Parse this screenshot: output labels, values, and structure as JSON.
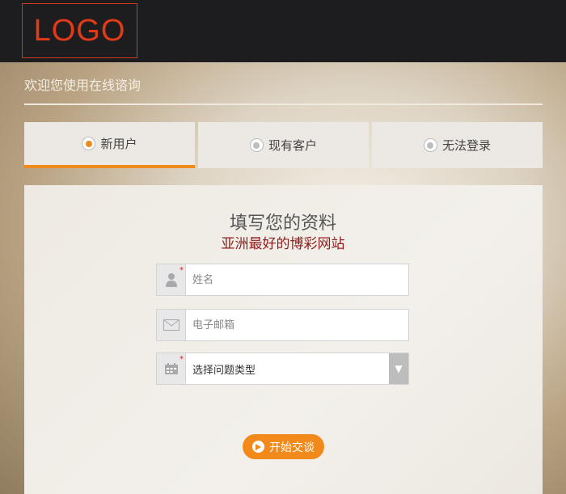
{
  "header": {
    "logo_text": "LOGO"
  },
  "welcome": {
    "text": "欢迎您使用在线谘询"
  },
  "tabs": [
    {
      "label": "新用户",
      "active": true
    },
    {
      "label": "现有客户",
      "active": false
    },
    {
      "label": "无法登录",
      "active": false
    }
  ],
  "form": {
    "title": "填写您的资料",
    "subtitle": "亚洲最好的博彩网站",
    "name_placeholder": "姓名",
    "email_placeholder": "电子邮箱",
    "type_select_value": "选择问题类型",
    "required_mark": "*"
  },
  "start_button": {
    "label": "开始交谈"
  },
  "colors": {
    "accent": "#ef8a1c",
    "logo_red": "#e23a17",
    "subtitle_red": "#8e1d1d",
    "topbar": "#1d1d20"
  },
  "icons": {
    "name": "user-icon",
    "email": "envelope-icon",
    "type": "calendar-icon",
    "select": "triangle-down-icon",
    "button": "play-circle-icon"
  }
}
